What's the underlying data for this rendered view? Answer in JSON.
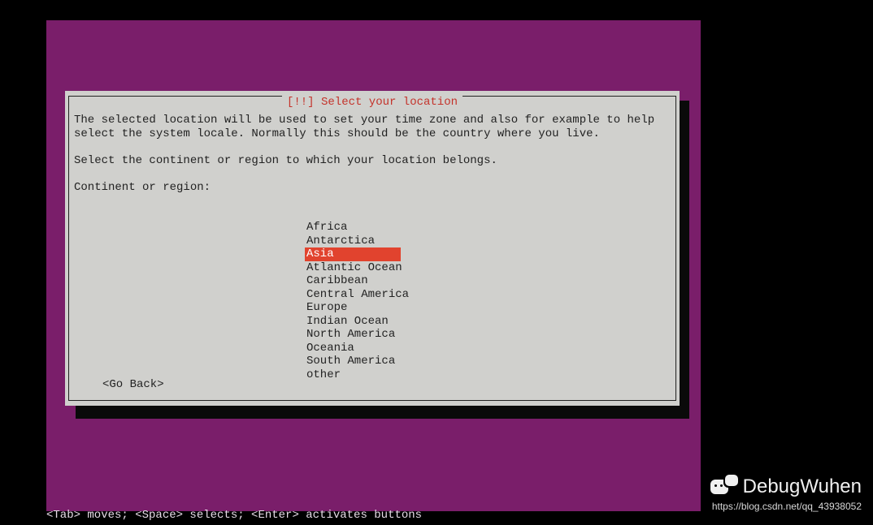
{
  "dialog": {
    "title": "[!!] Select your location",
    "paragraph1": "The selected location will be used to set your time zone and also for example to help select the system locale. Normally this should be the country where you live.",
    "paragraph2": "Select the continent or region to which your location belongs.",
    "prompt": "Continent or region:",
    "go_back": "<Go Back>"
  },
  "regions": [
    {
      "label": "Africa",
      "selected": false
    },
    {
      "label": "Antarctica",
      "selected": false
    },
    {
      "label": "Asia",
      "selected": true
    },
    {
      "label": "Atlantic Ocean",
      "selected": false
    },
    {
      "label": "Caribbean",
      "selected": false
    },
    {
      "label": "Central America",
      "selected": false
    },
    {
      "label": "Europe",
      "selected": false
    },
    {
      "label": "Indian Ocean",
      "selected": false
    },
    {
      "label": "North America",
      "selected": false
    },
    {
      "label": "Oceania",
      "selected": false
    },
    {
      "label": "South America",
      "selected": false
    },
    {
      "label": "other",
      "selected": false
    }
  ],
  "footer_hint": "<Tab> moves; <Space> selects; <Enter> activates buttons",
  "watermark": {
    "name": "DebugWuhen",
    "url": "https://blog.csdn.net/qq_43938052"
  }
}
